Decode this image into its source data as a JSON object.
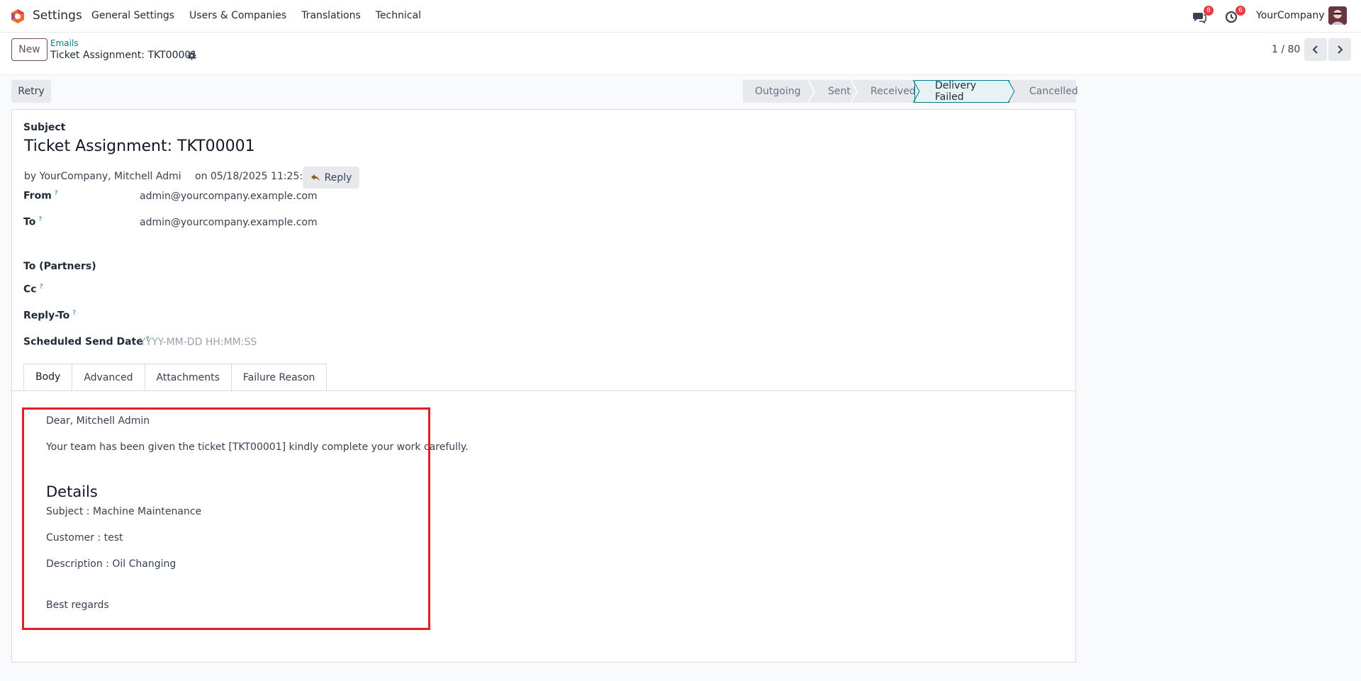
{
  "navbar": {
    "app_name": "Settings",
    "menu": [
      "General Settings",
      "Users & Companies",
      "Translations",
      "Technical"
    ],
    "messages_badge": "8",
    "activities_badge": "6",
    "company": "YourCompany"
  },
  "control_panel": {
    "new_label": "New",
    "breadcrumb_parent": "Emails",
    "breadcrumb_current": "Ticket Assignment: TKT00001",
    "pager": "1 / 80"
  },
  "actions": {
    "retry_label": "Retry"
  },
  "statusbar": {
    "stages": [
      "Outgoing",
      "Sent",
      "Received",
      "Delivery Failed",
      "Cancelled"
    ],
    "active": "Delivery Failed"
  },
  "form": {
    "subject_label": "Subject",
    "subject": "Ticket Assignment: TKT00001",
    "by_line": "by YourCompany, Mitchell Admi",
    "date_line": "on 05/18/2025 11:25:34",
    "reply_label": "Reply",
    "from_label": "From",
    "from_value": "admin@yourcompany.example.com",
    "to_label": "To",
    "to_value": "admin@yourcompany.example.com",
    "to_partners_label": "To (Partners)",
    "cc_label": "Cc",
    "reply_to_label": "Reply-To",
    "scheduled_label": "Scheduled Send Date",
    "scheduled_placeholder": "YYYY-MM-DD HH:MM:SS",
    "help_mark": "?"
  },
  "tabs": [
    "Body",
    "Advanced",
    "Attachments",
    "Failure Reason"
  ],
  "body": {
    "greeting": "Dear, Mitchell Admin",
    "intro": "Your team has been given the ticket [TKT00001] kindly complete your work carefully.",
    "details_heading": "Details",
    "subject_line": "Subject : Machine Maintenance",
    "customer_line": "Customer : test",
    "description_line": "Description : Oil Changing",
    "closing": "Best regards"
  },
  "colors": {
    "brand": "#714b67",
    "teal": "#017e84",
    "highlight": "#e11d26"
  }
}
